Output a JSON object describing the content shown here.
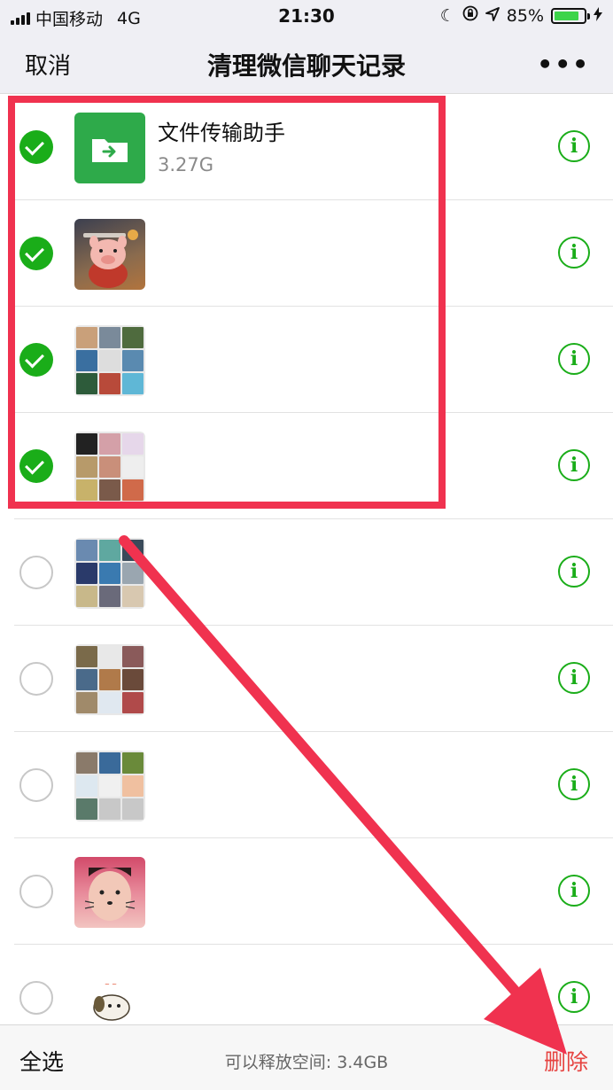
{
  "status_bar": {
    "carrier": "中国移动",
    "network": "4G",
    "time": "21:30",
    "battery_percent": "85%",
    "battery_level": 0.85,
    "icons": [
      "signal-icon",
      "moon-icon",
      "orientation-lock-icon",
      "location-icon",
      "battery-icon",
      "charging-icon"
    ]
  },
  "nav": {
    "cancel_label": "取消",
    "title": "清理微信聊天记录",
    "more_label": "•••"
  },
  "rows": [
    {
      "checked": true,
      "avatar": "file-transfer-icon",
      "name": "文件传输助手",
      "size": "3.27G"
    },
    {
      "checked": true,
      "avatar": "pig-photo"
    },
    {
      "checked": true,
      "avatar": "group-avatar"
    },
    {
      "checked": true,
      "avatar": "group-avatar"
    },
    {
      "checked": false,
      "avatar": "group-avatar"
    },
    {
      "checked": false,
      "avatar": "group-avatar"
    },
    {
      "checked": false,
      "avatar": "group-avatar"
    },
    {
      "checked": false,
      "avatar": "girl-photo"
    },
    {
      "checked": false,
      "avatar": "cartoon-avatar"
    }
  ],
  "info_icon_glyph": "i",
  "bottom": {
    "select_all_label": "全选",
    "free_space_label": "可以释放空间: 3.4GB",
    "delete_label": "删除"
  },
  "colors": {
    "accent_green": "#1aad19",
    "delete_red": "#e64340",
    "annotation_red": "#f0324f"
  }
}
